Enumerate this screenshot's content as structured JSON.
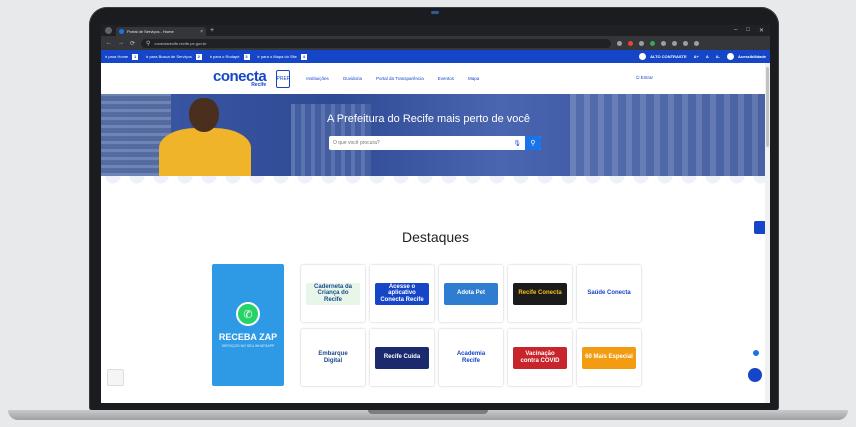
{
  "browser": {
    "tab_title": "Portal de Serviços - Home",
    "url": "conectarecife.recife.pe.gov.br",
    "window_controls": [
      "–",
      "□",
      "✕"
    ]
  },
  "bookmarks": {
    "items": [
      {
        "label": "ir para Home",
        "key": "1"
      },
      {
        "label": "ir para Busca de Serviços",
        "key": "2"
      },
      {
        "label": "ir para o Rodapé",
        "key": "3"
      },
      {
        "label": "ir para o Mapa do Site",
        "key": "4"
      }
    ],
    "contrast": "ALTO CONTRASTE",
    "font_controls": [
      "A+",
      "A",
      "A-"
    ],
    "accessibility": "Acessibilidade"
  },
  "header": {
    "logo_main": "conecta",
    "logo_sub": "Recife",
    "logo_badge": "PREF",
    "menu": [
      "Instituições",
      "Ouvidoria",
      "Portal da Transparência",
      "Eventos",
      "Mapa"
    ],
    "login": "Entrar"
  },
  "hero": {
    "title": "A Prefeitura do Recife mais perto de você",
    "search_placeholder": "O que você procura?"
  },
  "destaques": {
    "title": "Destaques",
    "zap_title": "RECEBA ZAP",
    "zap_subtitle": "SERVIÇOS NO SEU WHATSAPP",
    "cards": [
      {
        "label": "Caderneta da Criança do Recife",
        "color": "#e8f5e9",
        "text_color": "#1a4b8c"
      },
      {
        "label": "Acesse o aplicativo Conecta Recife",
        "color": "#1646c8",
        "text_color": "#ffffff"
      },
      {
        "label": "Adota Pet",
        "color": "#2e7dd1",
        "text_color": "#ffffff"
      },
      {
        "label": "Recife Conecta",
        "color": "#1b1b1b",
        "text_color": "#f2c21b"
      },
      {
        "label": "Saúde Conecta",
        "color": "#ffffff",
        "text_color": "#1646c8"
      },
      {
        "label": "Embarque Digital",
        "color": "#ffffff",
        "text_color": "#1a4b8c"
      },
      {
        "label": "Recife Cuida",
        "color": "#1a2a6c",
        "text_color": "#ffffff"
      },
      {
        "label": "Academia Recife",
        "color": "#ffffff",
        "text_color": "#1646c8"
      },
      {
        "label": "Vacinação contra COVID",
        "color": "#c8242b",
        "text_color": "#ffffff"
      },
      {
        "label": "60 Mais Especial",
        "color": "#f39c12",
        "text_color": "#ffffff"
      }
    ]
  },
  "colors": {
    "brand_blue": "#1646c8",
    "bookmark_bar": "#1646c8",
    "zap_card": "#2e9ae6",
    "search_button": "#1a73e8"
  }
}
